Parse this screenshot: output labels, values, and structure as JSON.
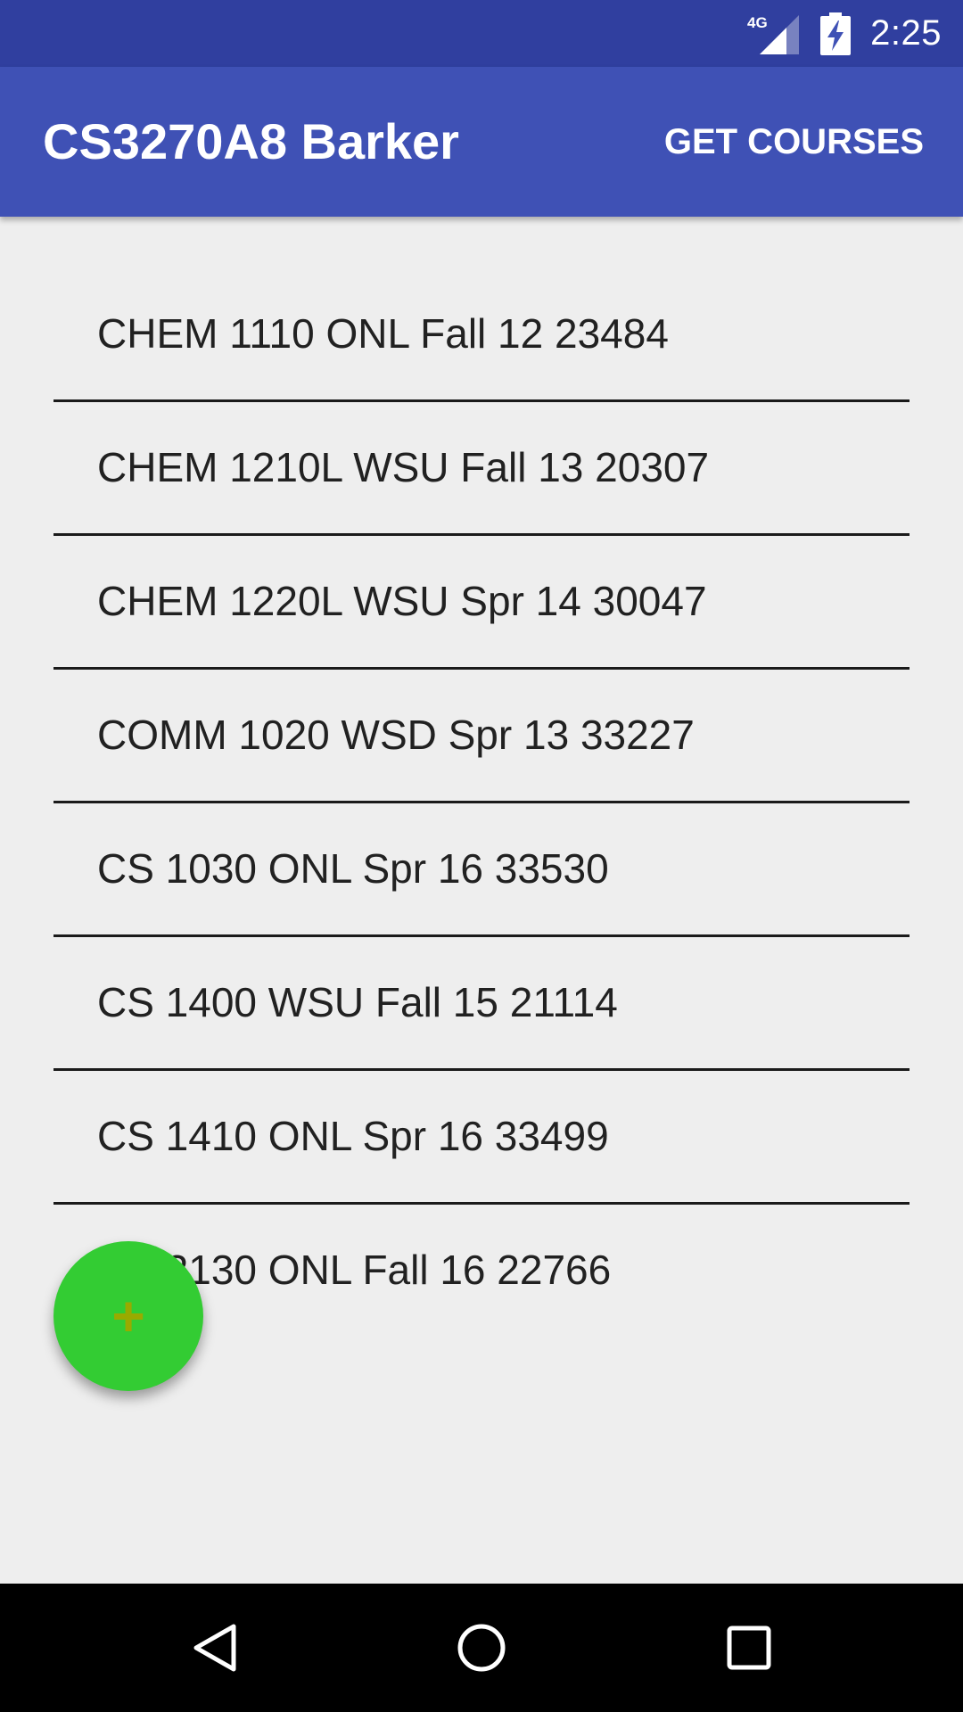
{
  "status_bar": {
    "network": "4G",
    "time": "2:25",
    "icons": [
      "signal-icon",
      "battery-charging-icon"
    ]
  },
  "app_bar": {
    "title": "CS3270A8 Barker",
    "action_label": "GET COURSES"
  },
  "courses": [
    "CHEM 1110 ONL Fall 12 23484",
    "CHEM 1210L WSU Fall 13 20307",
    "CHEM 1220L WSU Spr 14 30047",
    "COMM 1020 WSD Spr 13 33227",
    "CS 1030 ONL Spr 16 33530",
    "CS 1400 WSU Fall 15 21114",
    "CS 1410 ONL Spr 16 33499",
    "CS 2130 ONL Fall 16 22766"
  ],
  "fab": {
    "icon": "plus-icon",
    "symbol": "+"
  },
  "nav_bar": {
    "icons": [
      "back-icon",
      "home-icon",
      "recents-icon"
    ]
  },
  "colors": {
    "status_bar": "#303f9f",
    "app_bar": "#3f51b5",
    "fab": "#33cc33",
    "background": "#eeeeee"
  }
}
